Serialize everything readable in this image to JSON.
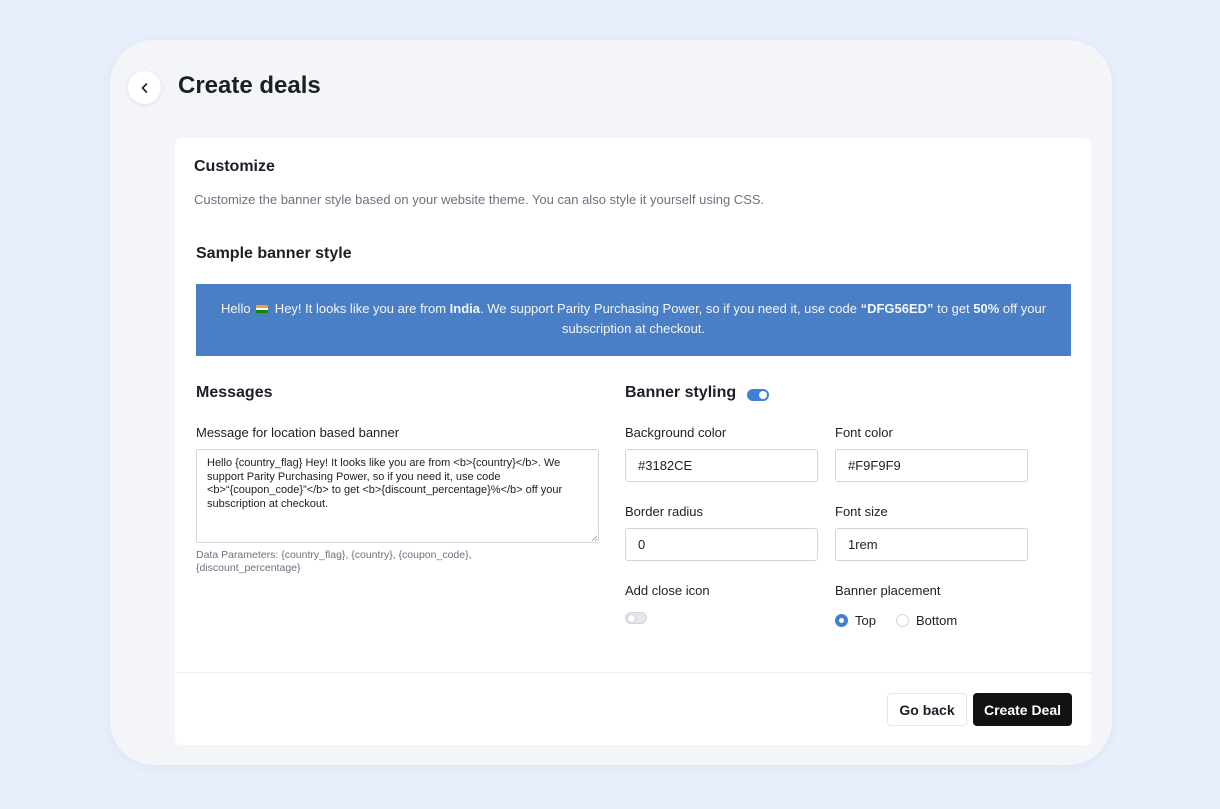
{
  "page": {
    "title": "Create deals"
  },
  "customize": {
    "title": "Customize",
    "description": "Customize the banner style based on your website theme. You can also style it yourself using CSS."
  },
  "sample": {
    "title": "Sample banner style",
    "banner": {
      "greeting": "Hello",
      "flag_icon": "india-flag-icon",
      "text1": " Hey! It looks like you are from ",
      "country": "India",
      "text2": ". We support Parity Purchasing Power, so if you need it, use code ",
      "code": "“DFG56ED”",
      "text3": " to get ",
      "discount": "50%",
      "text4": " off your subscription at checkout."
    }
  },
  "messages": {
    "title": "Messages",
    "label": "Message for location based banner",
    "value": "Hello {country_flag} Hey! It looks like you are from <b>{country}</b>. We support Parity Purchasing Power, so if you need it, use code <b>“{coupon_code}”</b> to get <b>{discount_percentage}%</b> off your subscription at checkout.",
    "help": "Data Parameters: {country_flag}, {country}, {coupon_code}, {discount_percentage}"
  },
  "styling": {
    "title": "Banner styling",
    "enabled": true,
    "background_color_label": "Background color",
    "background_color": "#3182CE",
    "font_color_label": "Font color",
    "font_color": "#F9F9F9",
    "border_radius_label": "Border radius",
    "border_radius": "0",
    "font_size_label": "Font size",
    "font_size": "1rem",
    "close_icon_label": "Add close icon",
    "close_icon_enabled": false,
    "placement_label": "Banner placement",
    "placement_options": [
      "Top",
      "Bottom"
    ],
    "placement_selected": "Top"
  },
  "footer": {
    "back_label": "Go back",
    "create_label": "Create Deal"
  },
  "colors": {
    "banner_bg": "#4a7fc6",
    "banner_fg": "#f3f6fb",
    "accent": "#3f7fd4",
    "primary_button": "#111111"
  },
  "icons": {
    "back": "chevron-left-icon"
  }
}
